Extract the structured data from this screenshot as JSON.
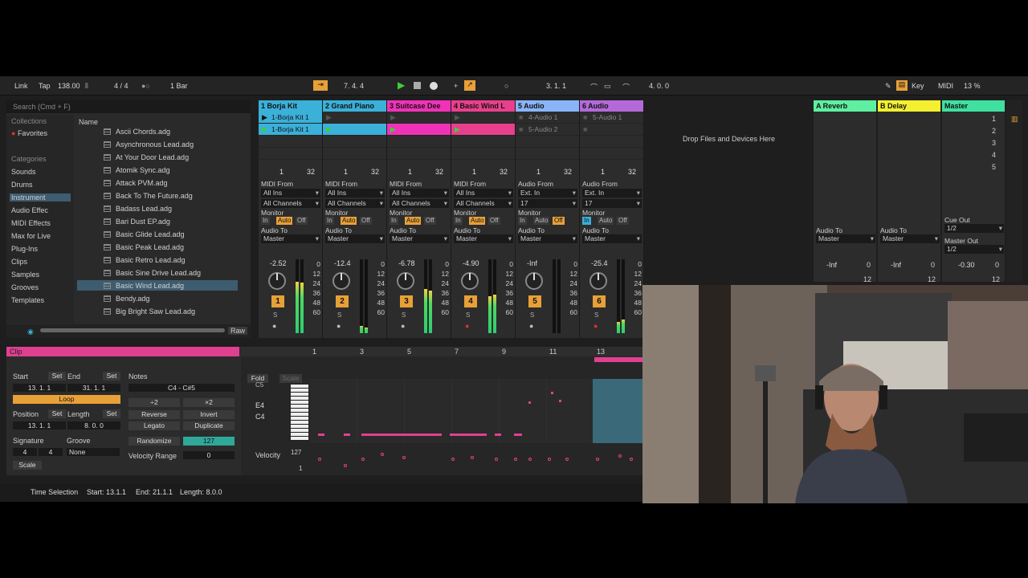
{
  "transport": {
    "link": "Link",
    "tap": "Tap",
    "tempo": "138.00",
    "time_sig": "4 / 4",
    "quant": "1 Bar",
    "position": "7.   4.   4",
    "loop_start": "3.   1.   1",
    "loop_len": "4.   0.   0",
    "key": "Key",
    "midi": "MIDI",
    "cpu": "13 %"
  },
  "browser": {
    "search_placeholder": "Search (Cmd + F)",
    "collections_label": "Collections",
    "favorites": "Favorites",
    "categories_label": "Categories",
    "categories": [
      "Sounds",
      "Drums",
      "Instrument",
      "Audio Effec",
      "MIDI Effects",
      "Max for Live",
      "Plug-Ins",
      "Clips",
      "Samples",
      "Grooves",
      "Templates"
    ],
    "name_header": "Name",
    "files": [
      "Ascii Chords.adg",
      "Asynchronous Lead.adg",
      "At Your Door Lead.adg",
      "Atomik Sync.adg",
      "Attack PVM.adg",
      "Back To The Future.adg",
      "Badass Lead.adg",
      "Bari Dust EP.adg",
      "Basic Glide Lead.adg",
      "Basic Peak Lead.adg",
      "Basic Retro Lead.adg",
      "Basic Sine Drive Lead.adg",
      "Basic Wind Lead.adg",
      "Bendy.adg",
      "Big Bright Saw Lead.adg"
    ],
    "raw": "Raw"
  },
  "tracks": [
    {
      "name": "1 Borja Kit",
      "color": "#3bb0d8",
      "clips": [
        "1-Borja Kit 1",
        "1-Borja Kit 1"
      ],
      "from_label": "MIDI From",
      "from": "All Ins",
      "channel": "All Channels",
      "vol": "-2.52",
      "num": "1",
      "monitor_active": "Auto"
    },
    {
      "name": "2 Grand Piano",
      "color": "#3bb0d8",
      "clips": [
        "",
        ""
      ],
      "from_label": "MIDI From",
      "from": "All Ins",
      "channel": "All Channels",
      "vol": "-12.4",
      "num": "2",
      "monitor_active": "Auto"
    },
    {
      "name": "3 Suitcase Dee",
      "color": "#f032b8",
      "clips": [
        "",
        ""
      ],
      "from_label": "MIDI From",
      "from": "All Ins",
      "channel": "All Channels",
      "vol": "-6.78",
      "num": "3",
      "monitor_active": "Auto"
    },
    {
      "name": "4 Basic Wind L",
      "color": "#e8408c",
      "clips": [
        "",
        ""
      ],
      "from_label": "MIDI From",
      "from": "All Ins",
      "channel": "All Channels",
      "vol": "-4.90",
      "num": "4",
      "monitor_active": "Auto"
    },
    {
      "name": "5 Audio",
      "color": "#8ab4f8",
      "clips": [
        "4-Audio 1",
        "5-Audio 2"
      ],
      "from_label": "Audio From",
      "from": "Ext. In",
      "channel": "17",
      "vol": "-Inf",
      "num": "5",
      "monitor_active": "Off"
    },
    {
      "name": "6 Audio",
      "color": "#b36ad8",
      "clips": [
        "5-Audio 1",
        ""
      ],
      "from_label": "Audio From",
      "from": "Ext. In",
      "channel": "17",
      "vol": "-25.4",
      "num": "6",
      "monitor_active": "In"
    }
  ],
  "labels": {
    "monitor": "Monitor",
    "in": "In",
    "auto": "Auto",
    "off": "Off",
    "audio_to": "Audio To",
    "master": "Master",
    "drop": "Drop Files and Devices Here",
    "cue_out": "Cue Out",
    "master_out": "Master Out",
    "half": "1/2",
    "scale_nums": [
      "0",
      "12",
      "24",
      "36",
      "48",
      "60"
    ],
    "clip_count": "32",
    "clip_one": "1"
  },
  "returns": [
    {
      "name": "A Reverb",
      "color": "#5ef0a0",
      "vol": "-Inf"
    },
    {
      "name": "B Delay",
      "color": "#f4f030",
      "vol": "-Inf"
    },
    {
      "name": "Master",
      "color": "#40e0a0",
      "vol": "-0.30"
    }
  ],
  "scenes": [
    "1",
    "2",
    "3",
    "4",
    "5"
  ],
  "clip": {
    "title": "Clip",
    "start": "Start",
    "set": "Set",
    "end": "End",
    "start_val": "13.   1.   1",
    "end_val": "31.   1.   1",
    "loop": "Loop",
    "position": "Position",
    "length": "Length",
    "pos_val": "13.   1.   1",
    "len_val": "8.   0.   0",
    "signature": "Signature",
    "groove": "Groove",
    "sig_num": "4",
    "sig_den": "4",
    "groove_val": "None",
    "scale": "Scale",
    "notes": "Notes",
    "range": "C4 - C#5",
    "x2div": "÷2",
    "x2": "×2",
    "reverse": "Reverse",
    "invert": "Invert",
    "legato": "Legato",
    "duplicate": "Duplicate",
    "randomize": "Randomize",
    "rand_val": "127",
    "vel_range": "Velocity Range",
    "vel_range_val": "0"
  },
  "midi": {
    "bars": [
      "1",
      "3",
      "5",
      "7",
      "9",
      "11",
      "13"
    ],
    "fold": "Fold",
    "scale": "Scale",
    "keys": [
      "C5",
      "E4",
      "C4"
    ],
    "velocity": "Velocity",
    "vmax": "127",
    "vmin": "1"
  },
  "status": {
    "sel": "Time Selection",
    "start": "Start: 13.1.1",
    "end": "End: 21.1.1",
    "length": "Length: 8.0.0"
  }
}
